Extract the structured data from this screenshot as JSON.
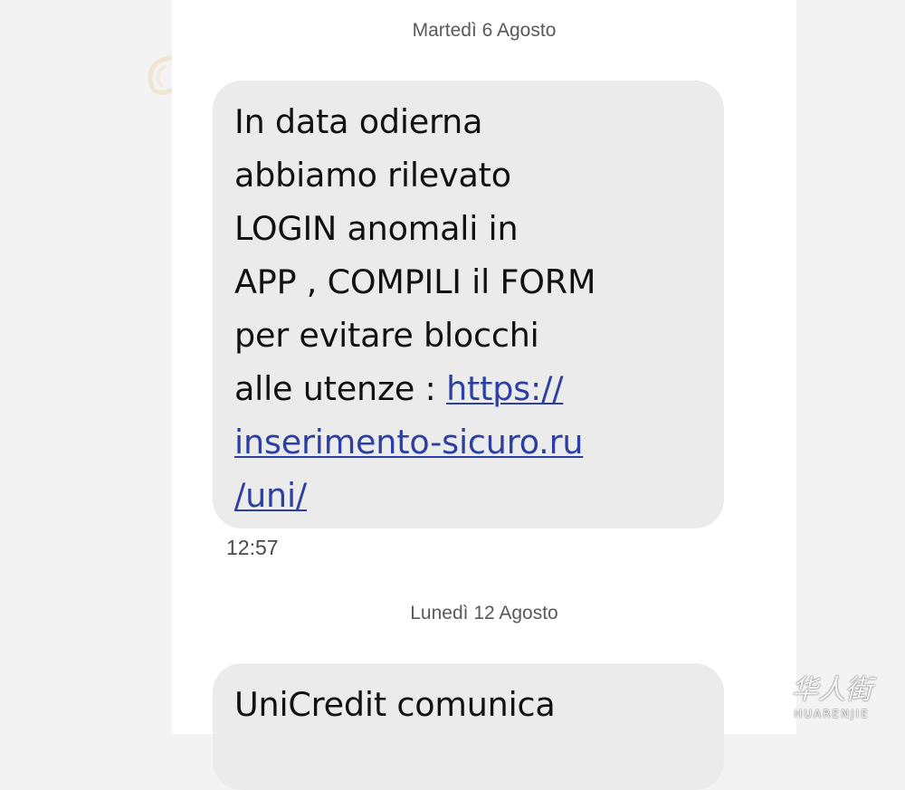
{
  "thread": {
    "groups": [
      {
        "date": "Martedì 6 Agosto",
        "message": {
          "lines": [
            "In data odierna",
            "abbiamo rilevato",
            "LOGIN anomali in",
            "APP , COMPILI il FORM",
            "per evitare blocchi"
          ],
          "pre_link": "alle utenze : ",
          "link_lines": [
            "https://",
            "inserimento-sicuro.ru",
            "/uni/"
          ],
          "time": "12:57"
        }
      },
      {
        "date": "Lunedì 12 Agosto",
        "message": {
          "lines": [
            "UniCredit comunica"
          ]
        }
      }
    ]
  },
  "watermark": {
    "cjk": "华人街",
    "latin": "HUARENJIE"
  },
  "colors": {
    "page_background": "#f3f3f3",
    "screen_background": "#ffffff",
    "bubble_background": "#ebebeb",
    "link": "#2c3fa3",
    "date_text": "#595959"
  }
}
